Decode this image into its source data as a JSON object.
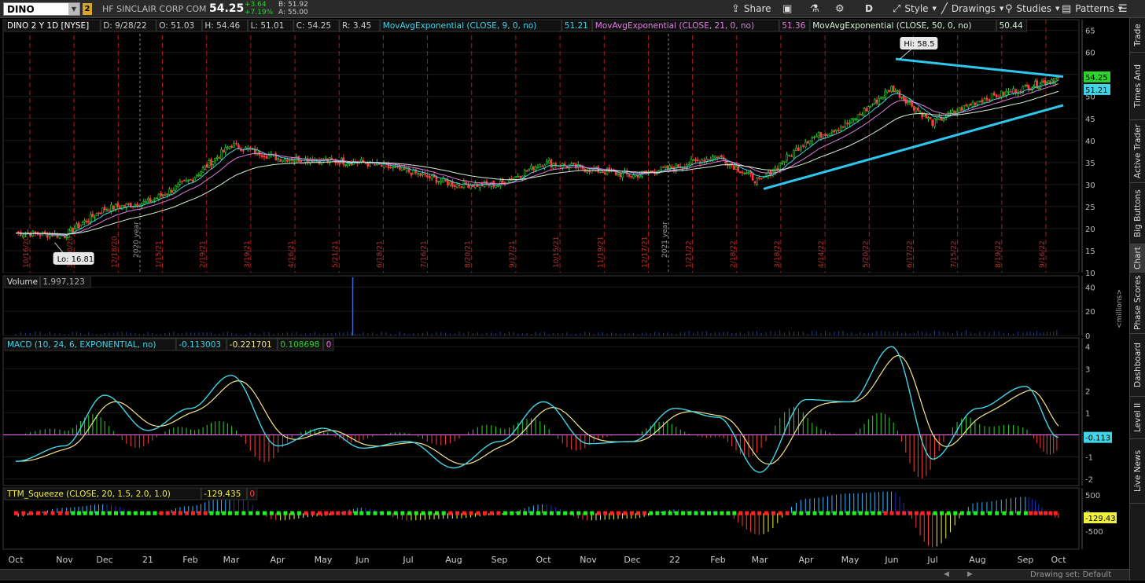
{
  "toolbar": {
    "symbol": "DINO",
    "link_number": "2",
    "company": "HF SINCLAIR CORP COM",
    "last": "54.25",
    "change": "+3.64",
    "change_pct": "+7.19%",
    "bid": "B: 51.92",
    "ask": "A: 55.00",
    "buttons": {
      "share": "Share",
      "period": "D",
      "style": "Style",
      "drawings": "Drawings",
      "studies": "Studies",
      "patterns": "Patterns"
    }
  },
  "header": {
    "title": "DINO 2 Y 1D [NYSE]",
    "date": "D: 9/28/22",
    "open": "O: 51.03",
    "high": "H: 54.46",
    "low": "L: 51.01",
    "close": "C: 54.25",
    "range": "R: 3.45",
    "studies": [
      {
        "label": "MovAvgExponential (CLOSE, 9, 0, no)",
        "value": "51.21",
        "color": "#3fd5e8"
      },
      {
        "label": "MovAvgExponential (CLOSE, 21, 0, no)",
        "value": "51.36",
        "color": "#e07fe0"
      },
      {
        "label": "MovAvgExponential (CLOSE, 50, 0, no)",
        "value": "50.44",
        "color": "#d8f0d8"
      }
    ]
  },
  "price_panel": {
    "hi_label": "Hi: 58.5",
    "lo_label": "Lo: 16.81",
    "last_badge": "54.25",
    "ema_badge": "51.21",
    "y_ticks": [
      "65",
      "60",
      "55",
      "50",
      "45",
      "40",
      "35",
      "30",
      "25",
      "20",
      "15",
      "10"
    ],
    "year_markers": [
      "2020 year",
      "2021 year"
    ],
    "expiry_dates": [
      "10/16/20",
      "11/20/20",
      "12/18/20",
      "1/15/21",
      "2/19/21",
      "3/19/21",
      "4/16/21",
      "5/21/21",
      "6/18/21",
      "7/16/21",
      "8/20/21",
      "9/17/21",
      "10/15/21",
      "11/19/21",
      "12/17/21",
      "1/21/22",
      "2/18/22",
      "3/18/22",
      "4/14/22",
      "5/20/22",
      "6/17/22",
      "7/15/22",
      "8/19/22",
      "9/16/22"
    ]
  },
  "volume_panel": {
    "label": "Volume",
    "value": "1,997,123",
    "y_ticks": [
      "40",
      "20",
      "0"
    ],
    "units": "<millions>"
  },
  "macd_panel": {
    "label": "MACD (10, 24, 6, EXPONENTIAL, no)",
    "value": "-0.113003",
    "avg": "-0.221701",
    "diff": "0.108698",
    "zero": "0",
    "badge": "-0.113",
    "y_ticks": [
      "4",
      "3",
      "2",
      "1",
      "0",
      "-1",
      "-2"
    ]
  },
  "ttm_panel": {
    "label": "TTM_Squeeze (CLOSE, 20, 1.5, 2.0, 1.0)",
    "value": "-129.435",
    "zero": "0",
    "badge": "-129.43",
    "y_ticks": [
      "500",
      "0",
      "-500"
    ]
  },
  "x_axis": [
    "Oct",
    "Nov",
    "Dec",
    "21",
    "Feb",
    "Mar",
    "Apr",
    "May",
    "Jun",
    "Jul",
    "Aug",
    "Sep",
    "Oct",
    "Nov",
    "Dec",
    "22",
    "Feb",
    "Mar",
    "Apr",
    "May",
    "Jun",
    "Jul",
    "Aug",
    "Sep",
    "Oct"
  ],
  "bottom_bar": {
    "drawing_set": "Drawing set: Default"
  },
  "side_tabs": [
    "Trade",
    "Times And Sales",
    "Active Trader",
    "Big Buttons",
    "Chart",
    "Phase Scores",
    "Dashboard",
    "Level II",
    "Live News"
  ],
  "chart_data": {
    "type": "line",
    "title": "DINO 2 Y 1D [NYSE]",
    "x": [
      "2020-10",
      "2020-11",
      "2020-12",
      "2021-01",
      "2021-02",
      "2021-03",
      "2021-04",
      "2021-05",
      "2021-06",
      "2021-07",
      "2021-08",
      "2021-09",
      "2021-10",
      "2021-11",
      "2021-12",
      "2022-01",
      "2022-02",
      "2022-03",
      "2022-04",
      "2022-05",
      "2022-06",
      "2022-07",
      "2022-08",
      "2022-09",
      "2022-09-28"
    ],
    "series": [
      {
        "name": "DINO",
        "values": [
          19,
          18.5,
          24.5,
          26,
          31,
          39,
          36,
          35.5,
          35,
          33,
          30,
          30,
          35,
          33.5,
          32,
          34,
          36.5,
          30.5,
          40,
          44,
          52,
          44,
          49,
          52,
          54.25
        ]
      }
    ],
    "ylim": [
      10,
      66
    ],
    "annotations": {
      "hi": 58.5,
      "lo": 16.81,
      "last": 54.25
    },
    "trendlines": {
      "upper": [
        [
          "2022-06",
          58.5
        ],
        [
          "2022-09-28",
          54.5
        ]
      ],
      "lower": [
        [
          "2022-03",
          29
        ],
        [
          "2022-09-28",
          48
        ]
      ]
    },
    "volume_millions": {
      "ylim": [
        0,
        48
      ],
      "spike": {
        "x": "2021-05",
        "value": 48
      }
    },
    "macd": {
      "ylim": [
        -2.3,
        4.4
      ],
      "x": [
        "2020-10",
        "2020-11",
        "2020-12",
        "2021-01",
        "2021-02",
        "2021-03",
        "2021-04",
        "2021-05",
        "2021-06",
        "2021-07",
        "2021-08",
        "2021-09",
        "2021-10",
        "2021-11",
        "2021-12",
        "2022-01",
        "2022-02",
        "2022-03",
        "2022-04",
        "2022-05",
        "2022-06",
        "2022-07",
        "2022-08",
        "2022-09",
        "2022-09-28"
      ],
      "values": [
        -1.2,
        -0.5,
        1.8,
        0.2,
        1.2,
        2.7,
        -0.5,
        0.3,
        -0.6,
        -0.3,
        -1.5,
        -0.3,
        1.5,
        -0.4,
        -0.3,
        1.2,
        0.8,
        -1.7,
        1.6,
        1.5,
        4.0,
        -1.1,
        1.2,
        2.2,
        -0.113
      ]
    },
    "ttm_squeeze": {
      "ylim": [
        -1000,
        700
      ],
      "x": [
        "2020-10",
        "2020-11",
        "2020-12",
        "2021-01",
        "2021-02",
        "2021-03",
        "2021-04",
        "2021-05",
        "2021-06",
        "2021-07",
        "2021-08",
        "2021-09",
        "2021-10",
        "2021-11",
        "2021-12",
        "2022-01",
        "2022-02",
        "2022-03",
        "2022-04",
        "2022-05",
        "2022-06",
        "2022-07",
        "2022-08",
        "2022-09",
        "2022-09-28"
      ],
      "values": [
        -100,
        150,
        250,
        -50,
        200,
        550,
        -200,
        -80,
        150,
        -200,
        -150,
        -50,
        250,
        -200,
        -150,
        100,
        50,
        -600,
        400,
        550,
        600,
        -950,
        300,
        450,
        -129.435
      ]
    }
  },
  "colors": {
    "up": "#2bd52b",
    "down": "#ff3b3b",
    "ema9": "#3fd5e8",
    "ema21": "#e07fe0",
    "ema50": "#d8f0d8",
    "trendline": "#2ec7ef",
    "macd": "#3fd5e8",
    "macd_avg": "#f5e68a",
    "zero_line": "#ff60ff"
  }
}
